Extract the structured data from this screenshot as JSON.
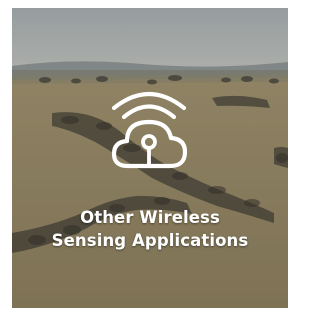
{
  "card": {
    "title_line_1": "Other Wireless",
    "title_line_2": "Sensing Applications",
    "icon": "wireless-cloud-icon",
    "image": "wildebeest-migration-savanna-photo"
  },
  "colors": {
    "text": "#ffffff",
    "sky": "#b7bfc4",
    "grass": "#a8976f"
  }
}
